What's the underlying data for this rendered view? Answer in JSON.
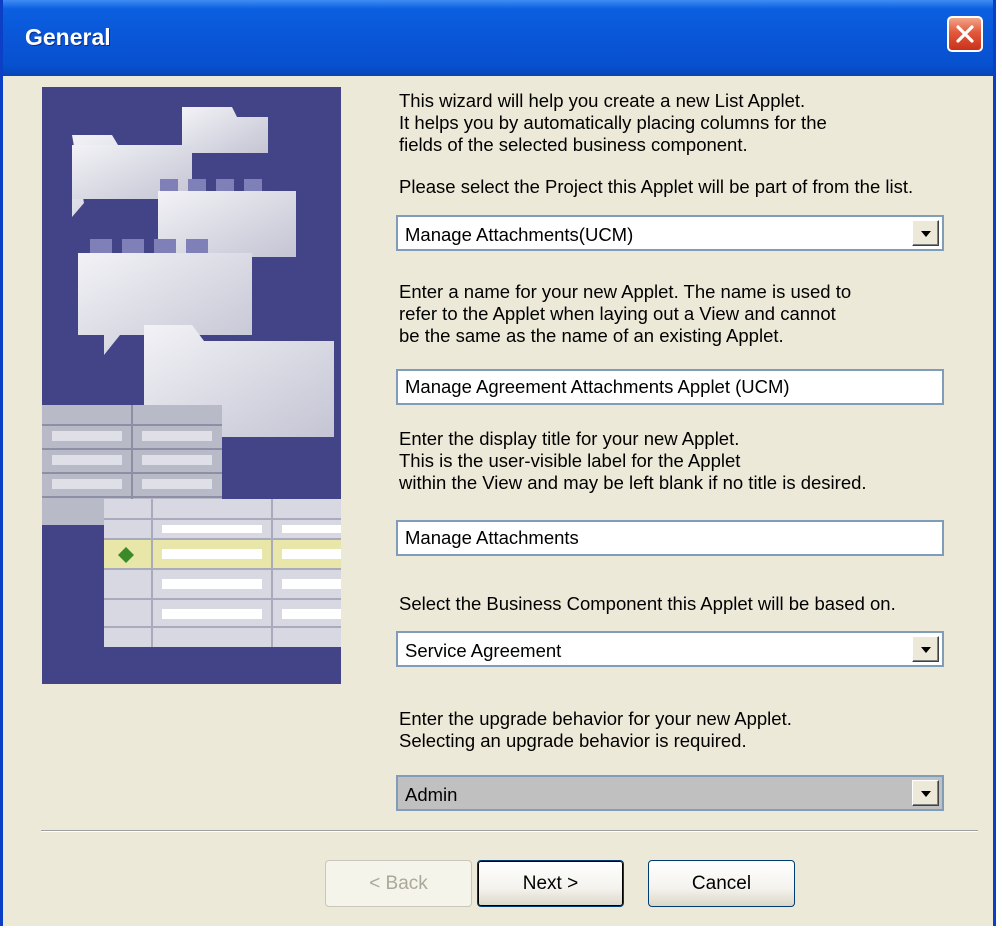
{
  "window": {
    "title": "General"
  },
  "intro": {
    "line1": "This wizard will help you create a new List Applet.\nIt helps you by automatically placing columns for the\nfields of the selected business component.",
    "line2": "Please select the Project this Applet will be part of from the list."
  },
  "project": {
    "selected": "Manage Attachments(UCM)"
  },
  "name_section": {
    "instructions": "Enter a name for your new Applet. The name is used to\nrefer to the Applet when laying out a View and cannot\nbe the same as the name of an existing Applet.",
    "value": "Manage Agreement Attachments Applet (UCM)"
  },
  "title_section": {
    "instructions": "Enter the display title for your new Applet.\nThis is the user-visible label for the Applet\nwithin the View and may be left blank if no title is desired.",
    "value": "Manage Attachments"
  },
  "bc_section": {
    "instructions": "Select the Business Component this Applet will be based on.",
    "selected": "Service Agreement"
  },
  "upgrade_section": {
    "instructions": "Enter the upgrade behavior for your new Applet.\nSelecting an upgrade behavior is required.",
    "selected": "Admin"
  },
  "buttons": {
    "back": "< Back",
    "next": "Next >",
    "cancel": "Cancel"
  },
  "colors": {
    "titlebar": "#0a56d8",
    "dialog_bg": "#ece9d8",
    "illustration_bg": "#424487",
    "close": "#e2583b"
  },
  "icons": {
    "close": "close-icon",
    "dropdown": "chevron-down-icon"
  }
}
